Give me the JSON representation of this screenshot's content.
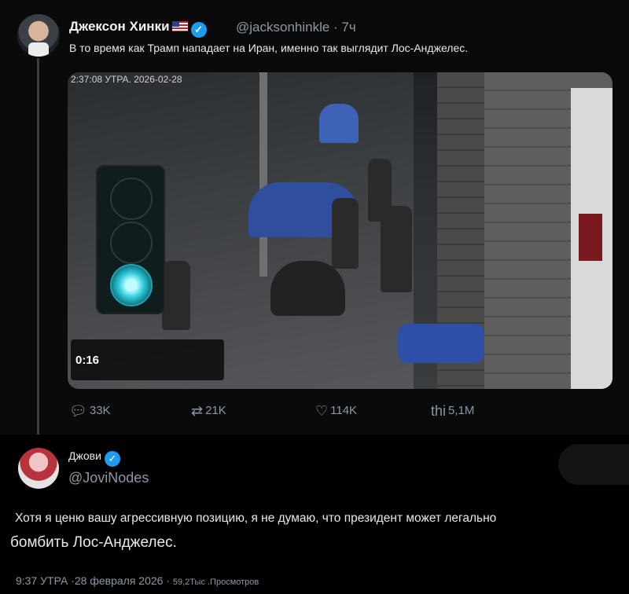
{
  "tweet": {
    "author_name": "Джексон Хинки",
    "verified_mark": "✓",
    "handle_time": "@jacksonhinkle · 7ч",
    "text": "В то время как Трамп нападает на Иран, именно так выглядит Лос-Анджелес.",
    "media": {
      "timestamp": "2:37:08 УТРА. 2026-02-28",
      "video_time": "0:16"
    },
    "stats": {
      "replies": "33K",
      "retweets": "21K",
      "likes": "114K",
      "views_prefix": "thi",
      "views": "5,1M"
    }
  },
  "reply": {
    "author_name": "Джови",
    "verified_mark": "✓",
    "handle": "@JoviNodes",
    "text_line1": "Хотя я ценю вашу агрессивную позицию, я не думаю, что президент может легально",
    "text_line2": "бомбить Лос-Анджелес.",
    "meta_time": "9:37 УТРА ·28 февраля 2026 ·",
    "meta_views": "59,2Тыс .Просмотров"
  },
  "colors": {
    "verified": "#1d9bf0",
    "secondary_text": "#8b98a5",
    "traffic_light": "#2ec9d9"
  },
  "icons": [
    "reply-icon",
    "retweet-icon",
    "like-icon",
    "views-icon",
    "verified-icon",
    "us-flag-icon"
  ]
}
